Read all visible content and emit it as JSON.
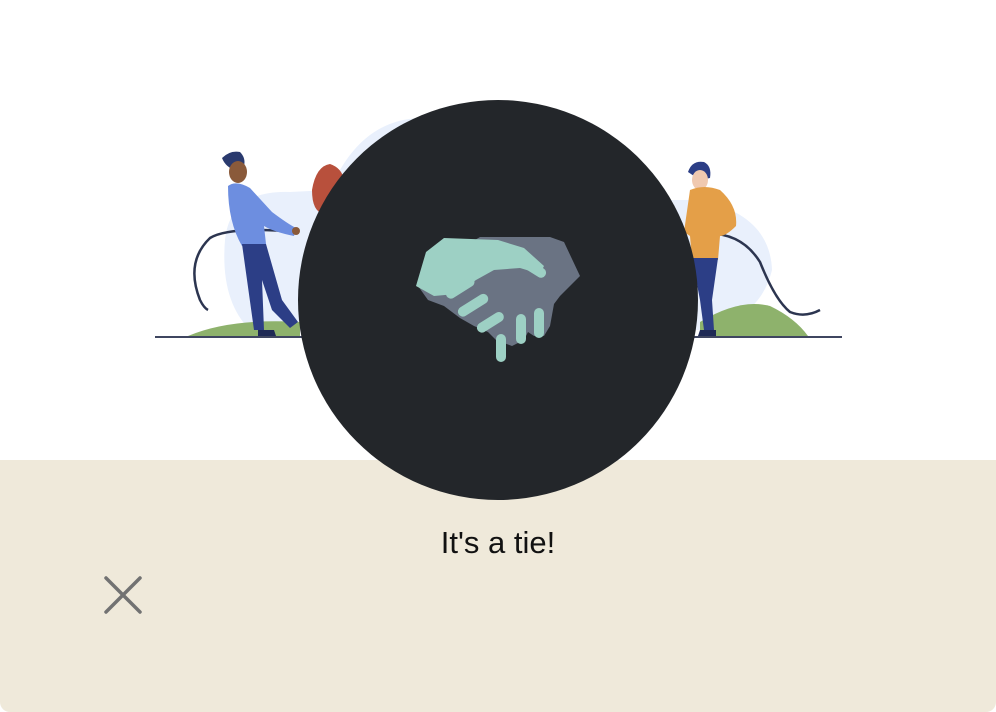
{
  "result": {
    "message": "It's a tie!",
    "icon": "handshake-icon"
  },
  "close_button": {
    "icon": "close-icon"
  },
  "colors": {
    "circle": "#23262a",
    "panel": "#efe9da",
    "handshake_light": "#9dd0c4",
    "handshake_dark": "#6a7383",
    "shirt_blue": "#6d8ee0",
    "shirt_orange": "#e49f48",
    "grass": "#8eb26c"
  }
}
